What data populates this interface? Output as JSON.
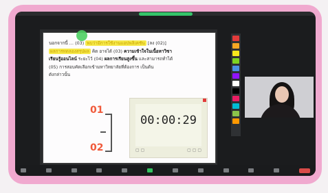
{
  "slide": {
    "line1": "นอกจากนี้ … (03)",
    "line1_hl": "พบว่ามีการใช้งานแอปพลิเคชัน",
    "line1_end": "[ลง (02)]",
    "line2_hl": "ผลการทดลองสรุปผล",
    "line2": "คิด อาจได้ (03)",
    "line2_bold": "ความเข้าใจในเนื้อหาวิชา",
    "line3_bold": "เรียนรู้ออนไลน์",
    "line3": "ระยะไว้ (04)",
    "line3_bold2": "ผลการเรียนสูงขึ้น",
    "line3_end": "และสามารถทำได้",
    "line4": "(05) การสอบคัดเลือกเข้ามหาวิทยาลัยที่ต้องการ เป็นต้น",
    "line5": "ดังกล่าวนั้น",
    "label_01": "01",
    "label_02": "02"
  },
  "timer": {
    "time": "00:00:29"
  },
  "palette_colors": [
    "#e23b3b",
    "#f5a623",
    "#f8e71c",
    "#7ed321",
    "#4a90e2",
    "#9013fe",
    "#ffffff",
    "#000000",
    "#e91e63",
    "#00bcd4",
    "#8bc34a",
    "#ff9800"
  ],
  "toolbar": {
    "buttons": [
      "mute",
      "video",
      "security",
      "participants",
      "chat",
      "share",
      "record",
      "reactions",
      "apps",
      "whiteboard",
      "more"
    ]
  }
}
